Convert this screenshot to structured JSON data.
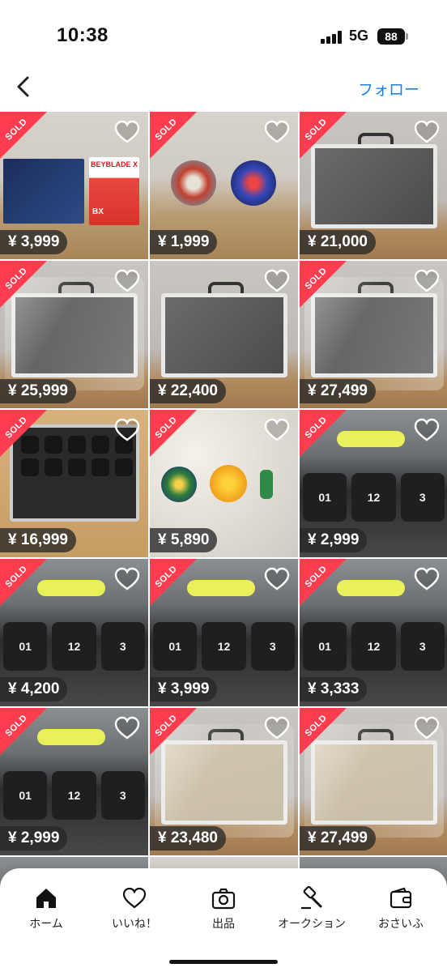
{
  "status_bar": {
    "time": "10:38",
    "network": "5G",
    "battery": "88"
  },
  "nav": {
    "back_icon": "chevron-left-icon",
    "follow_label": "フォロー",
    "follow_color": "#1d7fe0"
  },
  "badges": {
    "sold_label": "SOLD",
    "sold_color": "#ff3d4f"
  },
  "items": [
    {
      "price": "¥ 3,999",
      "sold": true,
      "photo": "box",
      "photo_text": "BEYBLADE X",
      "photo_sub": "BX"
    },
    {
      "price": "¥ 1,999",
      "sold": true,
      "photo": "beys"
    },
    {
      "price": "¥ 21,000",
      "sold": true,
      "photo": "case-dark"
    },
    {
      "price": "¥ 25,999",
      "sold": true,
      "photo": "case-wrapped"
    },
    {
      "price": "¥ 22,400",
      "sold": false,
      "photo": "case-dark"
    },
    {
      "price": "¥ 27,499",
      "sold": true,
      "photo": "case-wrapped"
    },
    {
      "price": "¥ 16,999",
      "sold": true,
      "photo": "foam-case"
    },
    {
      "price": "¥ 5,890",
      "sold": true,
      "photo": "bey-parts"
    },
    {
      "price": "¥ 2,999",
      "sold": true,
      "photo": "tray",
      "slots": [
        "01",
        "12",
        "3"
      ]
    },
    {
      "price": "¥ 4,200",
      "sold": true,
      "photo": "tray",
      "slots": [
        "01",
        "12",
        "3"
      ]
    },
    {
      "price": "¥ 3,999",
      "sold": true,
      "photo": "tray",
      "slots": [
        "01",
        "12",
        "3"
      ]
    },
    {
      "price": "¥ 3,333",
      "sold": true,
      "photo": "tray",
      "slots": [
        "01",
        "12",
        "3"
      ]
    },
    {
      "price": "¥ 2,999",
      "sold": true,
      "photo": "tray",
      "slots": [
        "01",
        "12",
        "3"
      ]
    },
    {
      "price": "¥ 23,480",
      "sold": true,
      "photo": "case-light"
    },
    {
      "price": "¥ 27,499",
      "sold": true,
      "photo": "case-light"
    }
  ],
  "tabs": [
    {
      "label": "ホーム",
      "icon": "home-icon",
      "active": true
    },
    {
      "label": "いいね！",
      "icon": "heart-icon",
      "active": false
    },
    {
      "label": "出品",
      "icon": "camera-icon",
      "active": false
    },
    {
      "label": "オークション",
      "icon": "gavel-icon",
      "active": false
    },
    {
      "label": "おさいふ",
      "icon": "wallet-icon",
      "active": false
    }
  ]
}
